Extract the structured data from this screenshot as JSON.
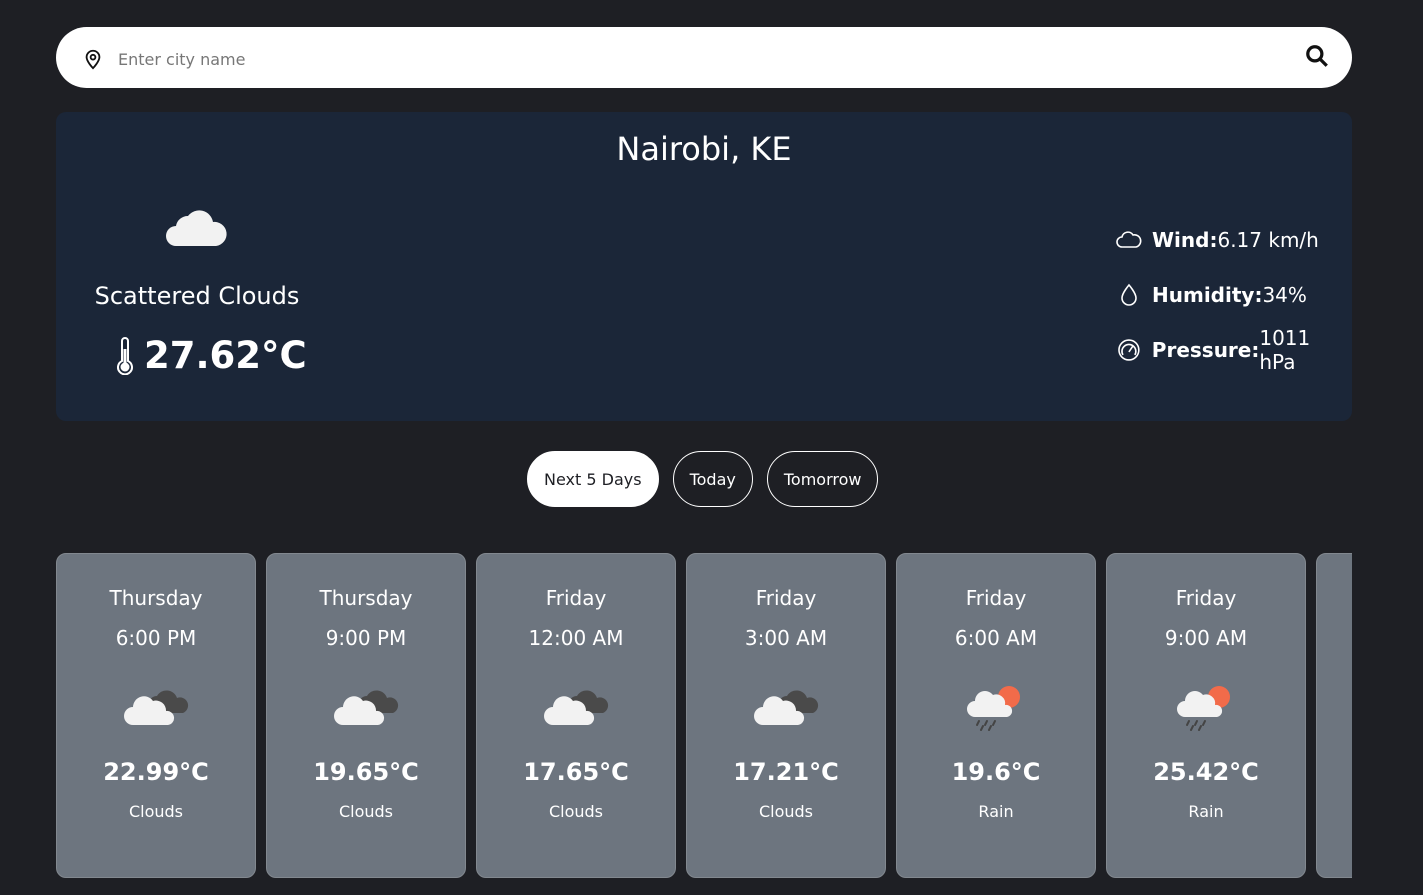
{
  "search": {
    "placeholder": "Enter city name",
    "value": ""
  },
  "current": {
    "city": "Nairobi, KE",
    "description": "Scattered Clouds",
    "temperature": "27.62°C",
    "icon": "cloud-icon",
    "stats": {
      "wind_label": "Wind:",
      "wind_value": "6.17 km/h",
      "humidity_label": "Humidity:",
      "humidity_value": "34%",
      "pressure_label": "Pressure:",
      "pressure_value": "1011 hPa"
    }
  },
  "tabs": [
    {
      "label": "Next 5 Days",
      "active": true
    },
    {
      "label": "Today",
      "active": false
    },
    {
      "label": "Tomorrow",
      "active": false
    }
  ],
  "forecast": [
    {
      "day": "Thursday",
      "time": "6:00 PM",
      "temp": "22.99°C",
      "desc": "Clouds",
      "icon": "broken-clouds-icon"
    },
    {
      "day": "Thursday",
      "time": "9:00 PM",
      "temp": "19.65°C",
      "desc": "Clouds",
      "icon": "broken-clouds-icon"
    },
    {
      "day": "Friday",
      "time": "12:00 AM",
      "temp": "17.65°C",
      "desc": "Clouds",
      "icon": "broken-clouds-icon"
    },
    {
      "day": "Friday",
      "time": "3:00 AM",
      "temp": "17.21°C",
      "desc": "Clouds",
      "icon": "broken-clouds-icon"
    },
    {
      "day": "Friday",
      "time": "6:00 AM",
      "temp": "19.6°C",
      "desc": "Rain",
      "icon": "sun-rain-icon"
    },
    {
      "day": "Friday",
      "time": "9:00 AM",
      "temp": "25.42°C",
      "desc": "Rain",
      "icon": "sun-rain-icon"
    }
  ],
  "colors": {
    "background": "#1e1f24",
    "panel": "#1b2638",
    "card": "#6d757f"
  }
}
